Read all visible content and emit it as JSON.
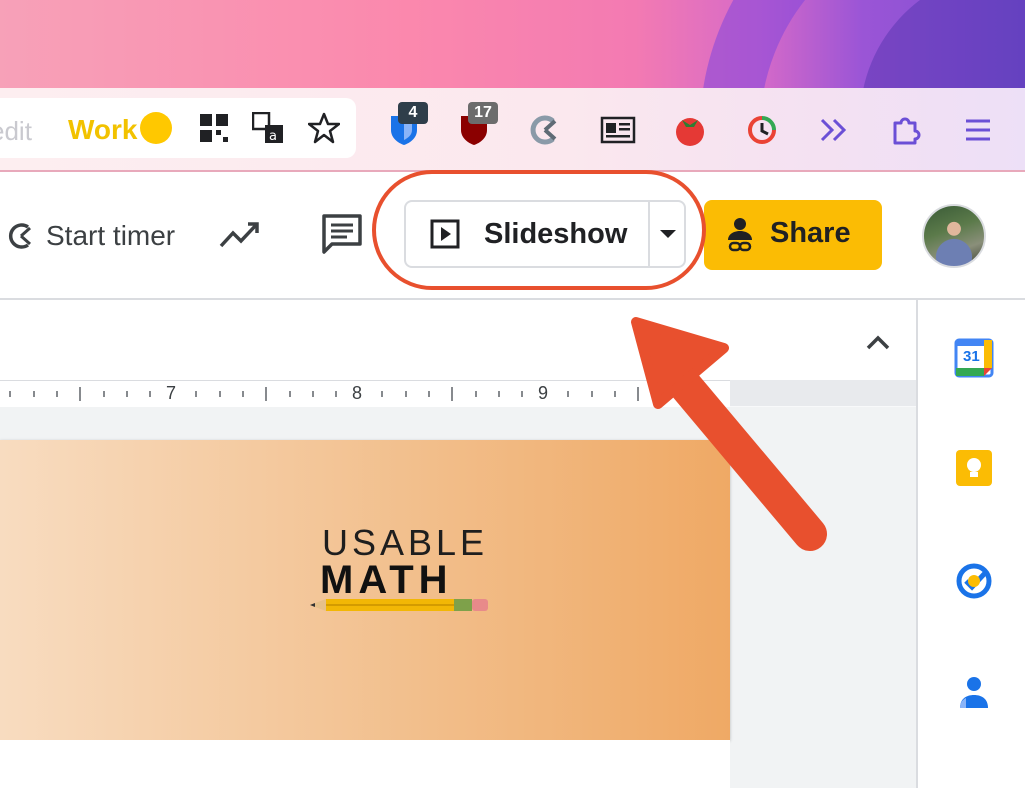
{
  "browser": {
    "omnibox_fragment": "edit",
    "profile_label": "Work",
    "extensions": [
      {
        "name": "bitwarden",
        "badge": "4"
      },
      {
        "name": "ublock",
        "badge": "17"
      },
      {
        "name": "clockify",
        "badge": ""
      },
      {
        "name": "reader",
        "badge": ""
      },
      {
        "name": "tomato-timer",
        "badge": ""
      },
      {
        "name": "history-clock",
        "badge": ""
      },
      {
        "name": "more-extensions",
        "badge": ""
      },
      {
        "name": "extensions-puzzle",
        "badge": ""
      },
      {
        "name": "chrome-menu",
        "badge": ""
      }
    ]
  },
  "header": {
    "start_timer_label": "Start timer",
    "slideshow_label": "Slideshow",
    "share_label": "Share"
  },
  "ruler": {
    "labels": [
      "7",
      "8",
      "9"
    ]
  },
  "slide": {
    "logo_top": "USABLE",
    "logo_bottom": "MATH"
  },
  "sidepanel": {
    "calendar_day": "31"
  },
  "colors": {
    "share_yellow": "#fbbc04",
    "annotation_red": "#e8502e",
    "profile_yellow": "#ffc800"
  }
}
